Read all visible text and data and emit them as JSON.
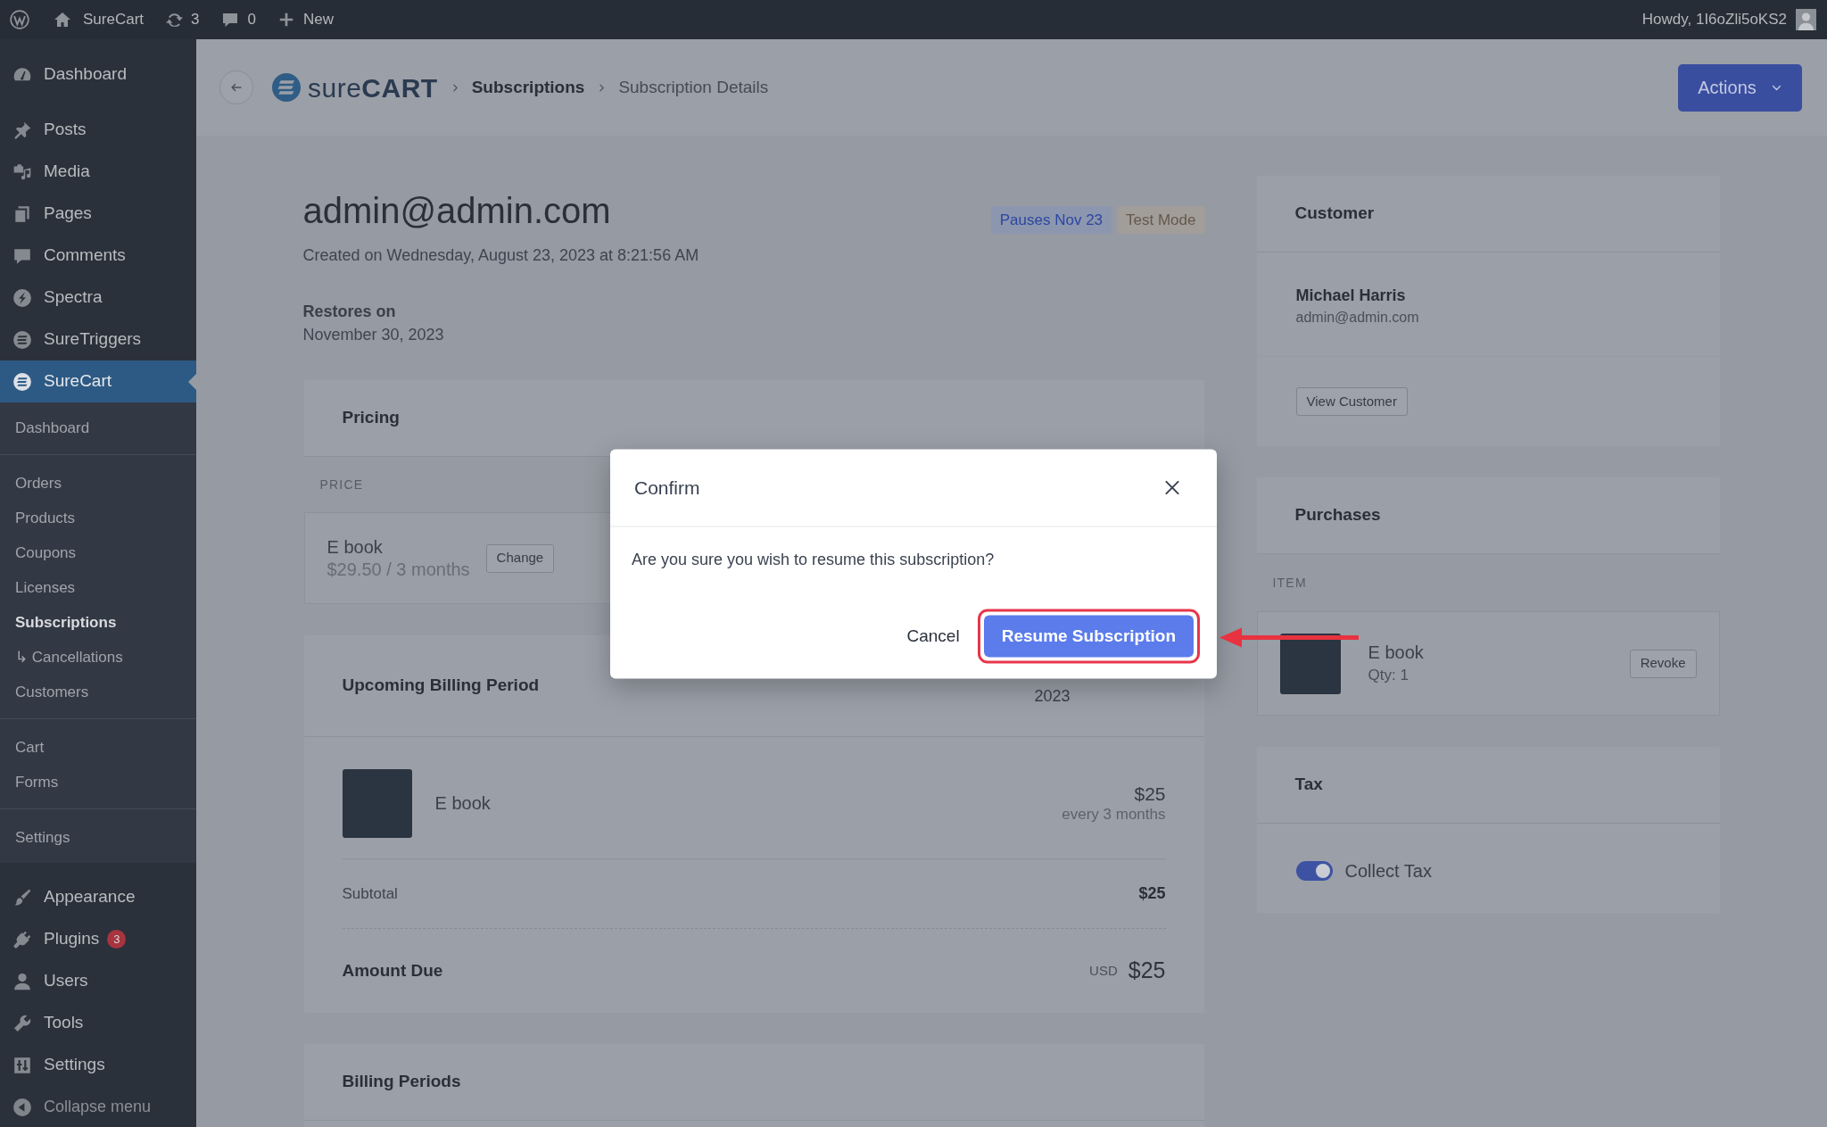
{
  "admin_bar": {
    "site_name": "SureCart",
    "updates_count": "3",
    "comments_count": "0",
    "new_label": "New",
    "greeting": "Howdy, 1I6oZli5oKS2"
  },
  "sidebar": {
    "groups": [
      {
        "items": [
          {
            "label": "Dashboard",
            "selected": false
          }
        ]
      },
      {
        "items": [
          {
            "label": "Posts",
            "selected": false
          },
          {
            "label": "Media",
            "selected": false
          },
          {
            "label": "Pages",
            "selected": false
          },
          {
            "label": "Comments",
            "selected": false
          },
          {
            "label": "Spectra",
            "selected": false
          },
          {
            "label": "SureTriggers",
            "selected": false
          },
          {
            "label": "SureCart",
            "selected": true,
            "submenu": [
              {
                "items": [
                  {
                    "label": "Dashboard",
                    "selected": false
                  }
                ]
              },
              {
                "items": [
                  {
                    "label": "Orders",
                    "selected": false
                  },
                  {
                    "label": "Products",
                    "selected": false
                  },
                  {
                    "label": "Coupons",
                    "selected": false
                  },
                  {
                    "label": "Licenses",
                    "selected": false
                  },
                  {
                    "label": "Subscriptions",
                    "selected": true
                  },
                  {
                    "label": "↳ Cancellations",
                    "selected": false
                  },
                  {
                    "label": "Customers",
                    "selected": false
                  }
                ]
              },
              {
                "items": [
                  {
                    "label": "Cart",
                    "selected": false
                  },
                  {
                    "label": "Forms",
                    "selected": false
                  }
                ]
              },
              {
                "items": [
                  {
                    "label": "Settings",
                    "selected": false
                  }
                ]
              }
            ]
          }
        ]
      },
      {
        "items": [
          {
            "label": "Appearance",
            "selected": false
          },
          {
            "label": "Plugins",
            "selected": false,
            "badge": "3"
          },
          {
            "label": "Users",
            "selected": false
          },
          {
            "label": "Tools",
            "selected": false
          },
          {
            "label": "Settings",
            "selected": false
          }
        ]
      }
    ],
    "collapse_label": "Collapse menu"
  },
  "header": {
    "logo": "sure**CART**",
    "breadcrumbs": [
      {
        "label": "Subscriptions",
        "current": false
      },
      {
        "label": "Subscription Details",
        "current": true
      }
    ],
    "action_button": "Actions"
  },
  "subscription": {
    "email": "admin@admin.com",
    "badges": [
      {
        "label": "Pauses Nov 23",
        "kind": "info"
      },
      {
        "label": "Test Mode",
        "kind": "warning"
      }
    ],
    "created": "Created on Wednesday, August 23, 2023 at 8:21:56 AM",
    "restores_label": "Restores on",
    "restores_date": "November 30, 2023"
  },
  "pricing": {
    "title": "Pricing",
    "column": "PRICE",
    "item": {
      "name": "E book",
      "price": "$29.50 / 3 months",
      "button": "Change"
    }
  },
  "upcoming_billing": {
    "title": "Upcoming Billing Period",
    "date_text": "2023",
    "line_items": [
      {
        "name": "E book",
        "amount": "$25",
        "interval": "every 3 months"
      }
    ],
    "subtotal": {
      "label": "Subtotal",
      "value": "$25"
    },
    "amount_due": {
      "label": "Amount Due",
      "currency": "USD",
      "value": "$25"
    }
  },
  "billing_periods": {
    "title": "Billing Periods"
  },
  "customer": {
    "title": "Customer",
    "name": "Michael Harris",
    "email": "admin@admin.com",
    "button": "View Customer"
  },
  "purchases": {
    "title": "Purchases",
    "column": "ITEM",
    "items": [
      {
        "name": "E book",
        "quantity": "Qty: 1",
        "button": "Revoke"
      }
    ]
  },
  "tax": {
    "title": "Tax",
    "toggle": {
      "label": "Collect Tax",
      "on": true
    }
  },
  "modal": {
    "title": "Confirm",
    "message": "Are you sure you wish to resume this subscription?",
    "buttons": [
      {
        "label": "Cancel",
        "kind": "link",
        "highlighted": false
      },
      {
        "label": "Resume Subscription",
        "kind": "primary",
        "highlighted": true
      }
    ]
  }
}
